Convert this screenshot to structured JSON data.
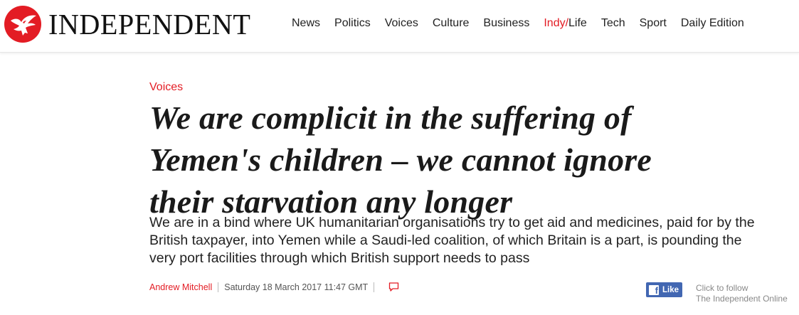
{
  "header": {
    "logo_text": "INDEPENDENT",
    "nav": [
      {
        "label": "News"
      },
      {
        "label": "Politics"
      },
      {
        "label": "Voices"
      },
      {
        "label": "Culture"
      },
      {
        "label": "Business"
      },
      {
        "label_prefix": "Indy/",
        "label": "Life"
      },
      {
        "label": "Tech"
      },
      {
        "label": "Sport"
      },
      {
        "label": "Daily Edition"
      }
    ]
  },
  "article": {
    "section": "Voices",
    "headline_lines": [
      "We are complicit in the suffering of",
      "Yemen's children – we cannot ignore",
      "their starvation any longer"
    ],
    "standfirst_lines": [
      "We are in a bind where UK humanitarian organisations try to get aid and medicines, paid for by the",
      "British taxpayer, into Yemen while a Saudi-led coalition, of which Britain is a part, is pounding the",
      "very port facilities through which British support needs to pass"
    ],
    "author": "Andrew Mitchell",
    "date": "Saturday 18 March 2017 11:47 GMT",
    "comment_icon": "speech-bubble-icon"
  },
  "social": {
    "like_label": "Like",
    "follow_line1": "Click to follow",
    "follow_line2": "The Independent Online"
  },
  "colors": {
    "brand_red": "#e31c24",
    "facebook_blue": "#4267b2",
    "text": "#1a1a1a"
  }
}
